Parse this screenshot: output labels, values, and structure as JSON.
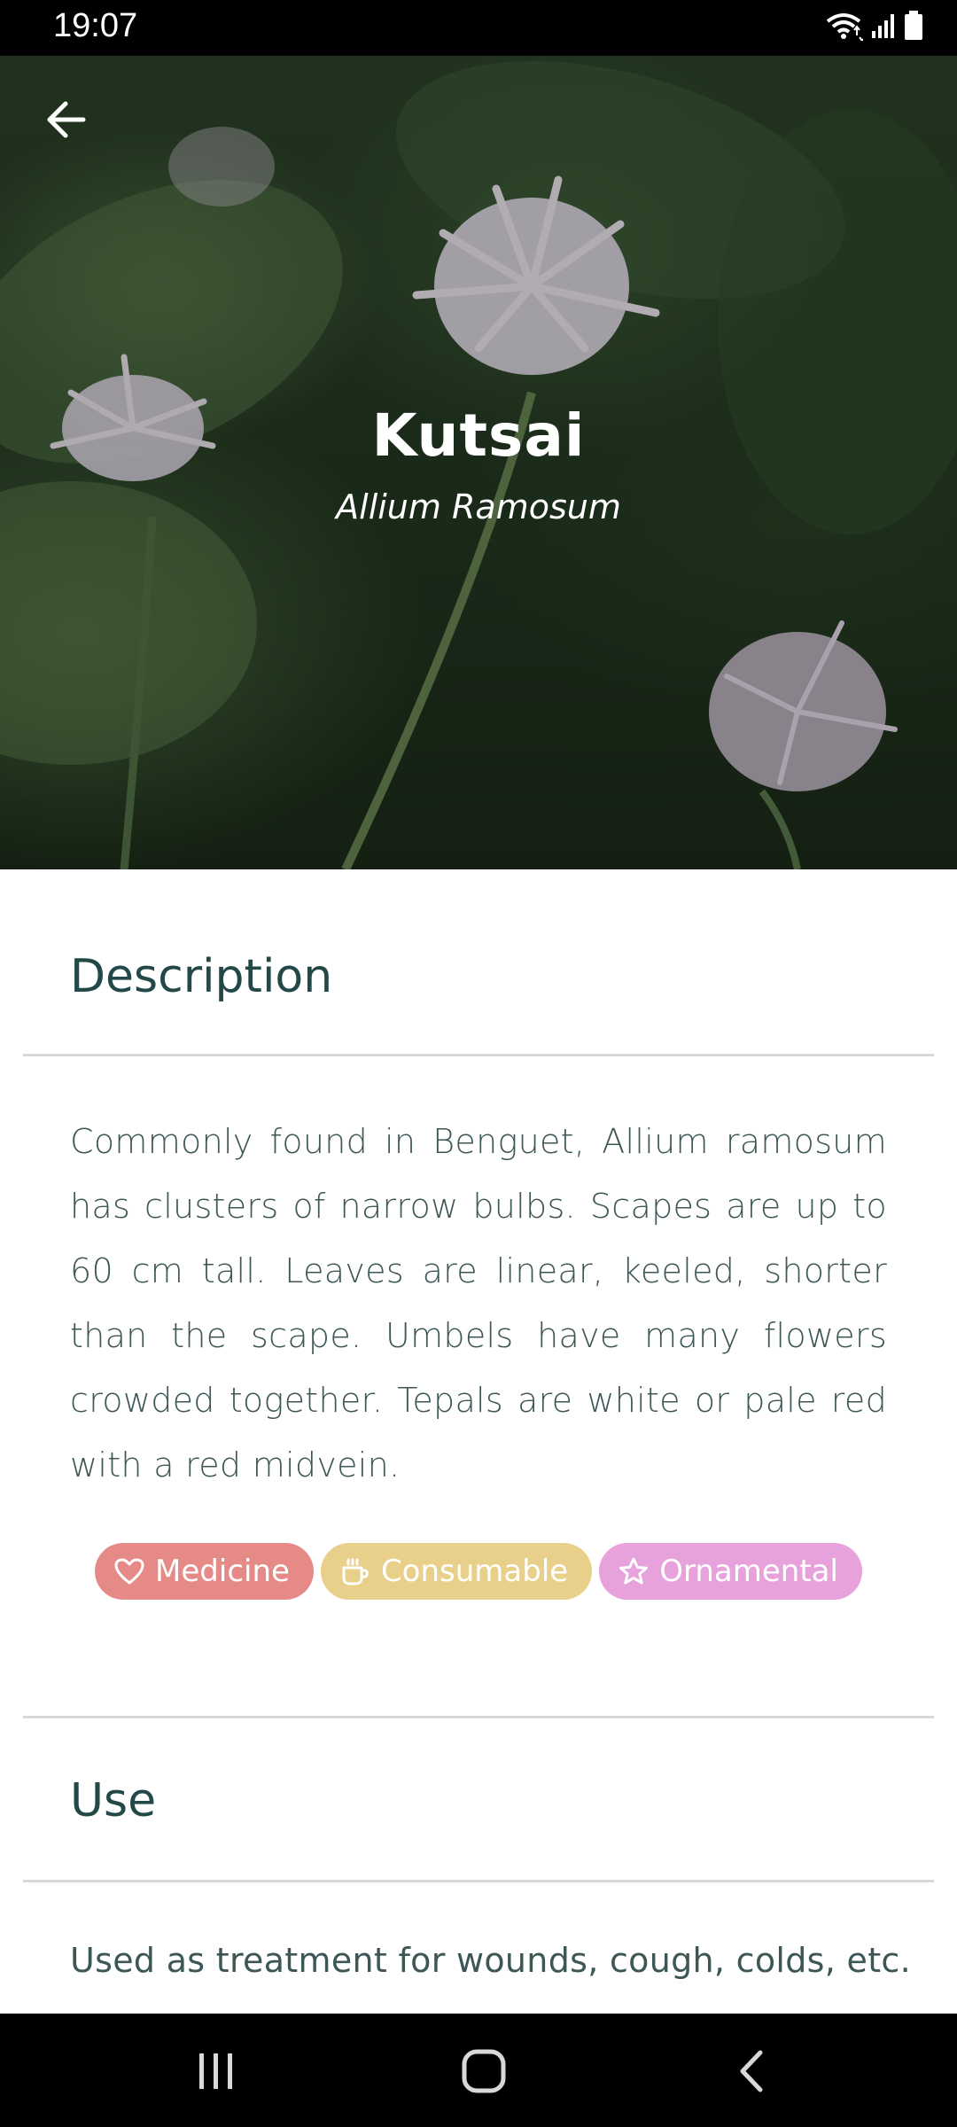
{
  "status_bar": {
    "time": "19:07",
    "icons": [
      "wifi-icon",
      "signal-icon",
      "battery-icon"
    ]
  },
  "plant": {
    "name": "Kutsai",
    "scientific_name": "Allium Ramosum"
  },
  "description": {
    "title": "Description",
    "text": "Commonly found in Benguet, Allium ramosum has clusters of narrow bulbs. Scapes are up to 60 cm tall. Leaves are linear, keeled, shorter than the scape. Umbels have many flowers crowded together. Tepals are white or pale red with a red midvein."
  },
  "tags": [
    {
      "label": "Medicine",
      "icon": "heart-icon",
      "color": "#e68a88"
    },
    {
      "label": "Consumable",
      "icon": "cup-icon",
      "color": "#e8cf8a"
    },
    {
      "label": "Ornamental",
      "icon": "star-icon",
      "color": "#e7a2dc"
    }
  ],
  "use": {
    "title": "Use",
    "text": "Used as treatment for wounds, cough, colds, etc."
  },
  "colors": {
    "heading": "#234848",
    "body_text": "#3d5656"
  }
}
